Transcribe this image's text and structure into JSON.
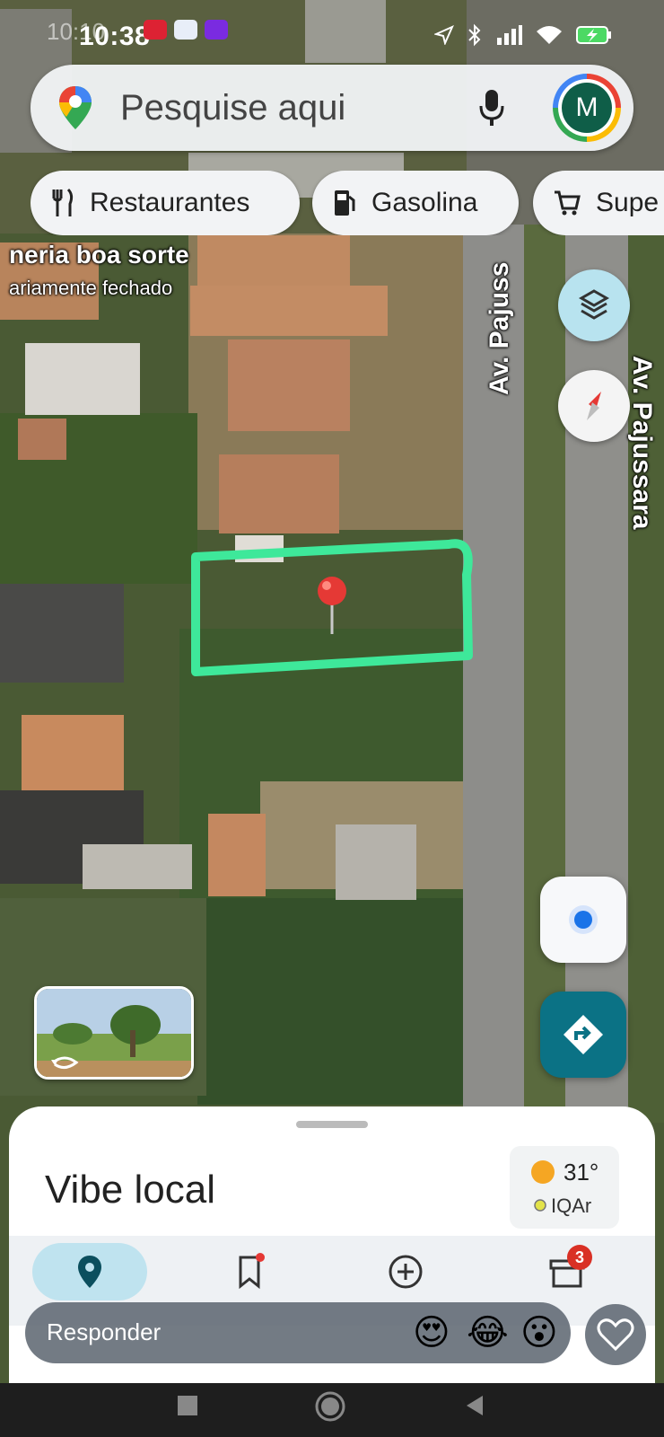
{
  "status_bar": {
    "time": "10:38",
    "time_ghost": "10:10"
  },
  "search": {
    "placeholder": "Pesquise aqui",
    "avatar_letter": "M"
  },
  "chips": [
    {
      "label": "Restaurantes",
      "icon": "fork-knife-icon"
    },
    {
      "label": "Gasolina",
      "icon": "gas-station-icon"
    },
    {
      "label": "Supe",
      "icon": "cart-icon"
    }
  ],
  "map": {
    "place_name": "neria boa sorte",
    "place_status": "ariamente fechado",
    "street_label_left": "Av. Pajuss",
    "street_label_right": "Av. Pajussara",
    "highlight_color": "#3ee89a",
    "pin_color": "#e53935"
  },
  "sheet": {
    "title": "Vibe local",
    "temperature": "31°",
    "aqi_label": "IQAr"
  },
  "bottom_nav": {
    "items": [
      {
        "name": "explore",
        "icon": "location-pin-icon",
        "active": true
      },
      {
        "name": "saved",
        "icon": "bookmark-icon",
        "has_dot": true
      },
      {
        "name": "contribute",
        "icon": "plus-circle-icon"
      },
      {
        "name": "business",
        "icon": "storefront-icon",
        "badge": "3"
      }
    ]
  },
  "reply": {
    "placeholder": "Responder",
    "emojis": [
      "😍",
      "😂",
      "😮"
    ]
  },
  "colors": {
    "directions_fab": "#0b7285",
    "accent_blue": "#1a73e8",
    "explore_pill": "#bfe3ef"
  }
}
